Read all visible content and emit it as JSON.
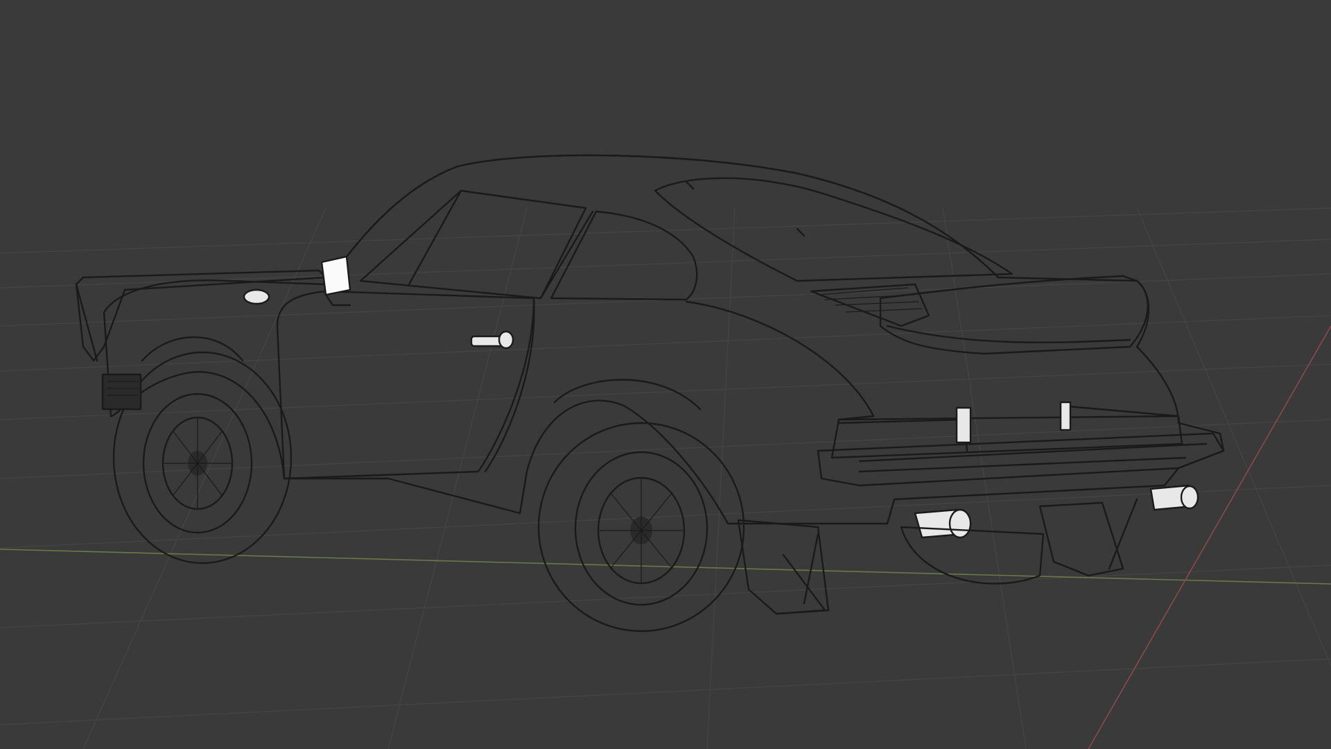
{
  "viewport": {
    "name": "3d-viewport",
    "shading_mode": "wireframe",
    "background_color": "#3a3a3a",
    "grid_color": "#444444",
    "x_axis_color": "#8a4a4a",
    "y_axis_color": "#6a7a4a",
    "wire_color": "#1a1a1a",
    "surface_color": "#fafafa"
  },
  "scene": {
    "object": "car-model",
    "icon_refs": [
      "car-wireframe-icon"
    ]
  }
}
